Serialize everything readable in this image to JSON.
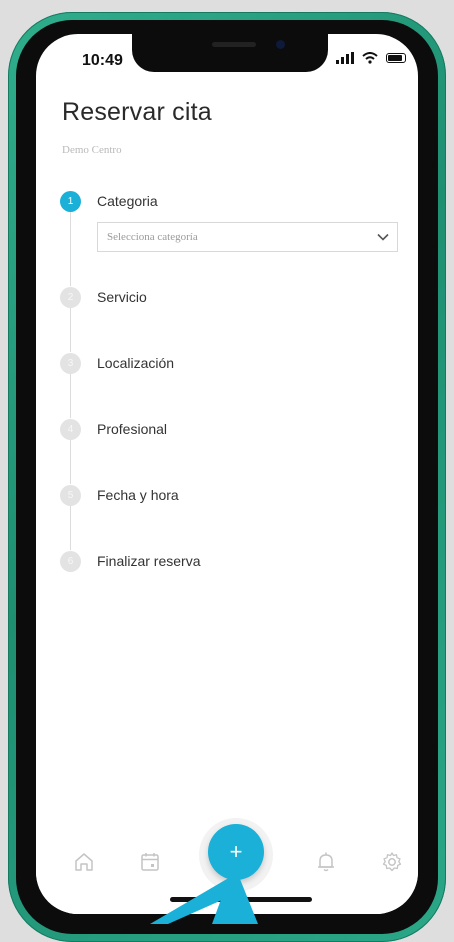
{
  "status_bar": {
    "time": "10:49"
  },
  "header": {
    "title": "Reservar cita",
    "subtitle": "Demo Centro"
  },
  "steps": [
    {
      "number": "1",
      "label": "Categoria",
      "active": true
    },
    {
      "number": "2",
      "label": "Servicio",
      "active": false
    },
    {
      "number": "3",
      "label": "Localización",
      "active": false
    },
    {
      "number": "4",
      "label": "Profesional",
      "active": false
    },
    {
      "number": "5",
      "label": "Fecha y hora",
      "active": false
    },
    {
      "number": "6",
      "label": "Finalizar reserva",
      "active": false
    }
  ],
  "category_select": {
    "placeholder": "Selecciona categoría"
  },
  "tab_bar": {
    "fab_label": "+",
    "icons": [
      "home-icon",
      "calendar-icon",
      "add-icon",
      "bell-icon",
      "gear-icon"
    ]
  },
  "colors": {
    "accent": "#1ab0d8",
    "frame": "#22a07f",
    "inactive_badge": "#e3e3e3"
  }
}
